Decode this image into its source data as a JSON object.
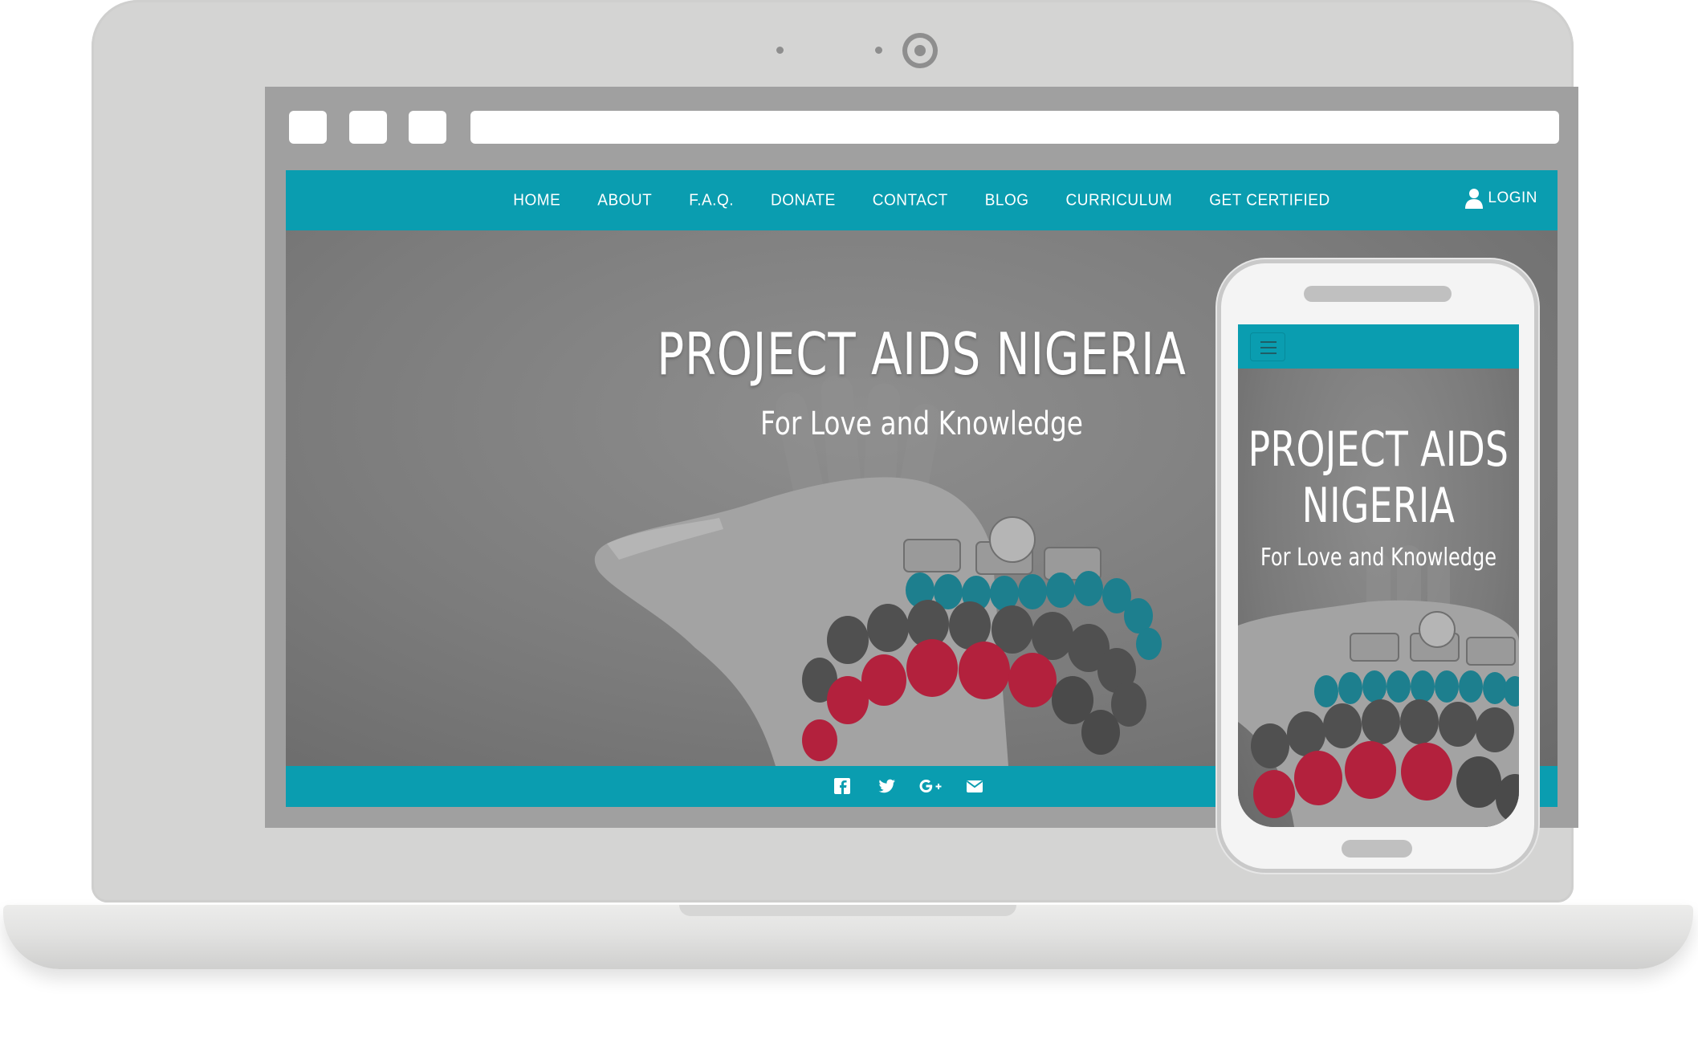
{
  "nav": {
    "items": [
      {
        "label": "HOME"
      },
      {
        "label": "ABOUT"
      },
      {
        "label": "F.A.Q."
      },
      {
        "label": "DONATE"
      },
      {
        "label": "CONTACT"
      },
      {
        "label": "BLOG"
      },
      {
        "label": "CURRICULUM"
      },
      {
        "label": "GET CERTIFIED"
      }
    ],
    "login_label": "LOGIN"
  },
  "hero": {
    "title": "PROJECT AIDS NIGERIA",
    "subtitle": "For Love and Knowledge"
  },
  "mobile": {
    "title_line1": "PROJECT AIDS",
    "title_line2": "NIGERIA",
    "subtitle": "For Love and Knowledge"
  },
  "social": [
    "facebook-icon",
    "twitter-icon",
    "google-plus-icon",
    "envelope-icon"
  ],
  "colors": {
    "brand": "#0a9db0",
    "device": "#d4d4d3",
    "bead_teal": "#1d7f8e",
    "bead_red": "#b3213d"
  }
}
